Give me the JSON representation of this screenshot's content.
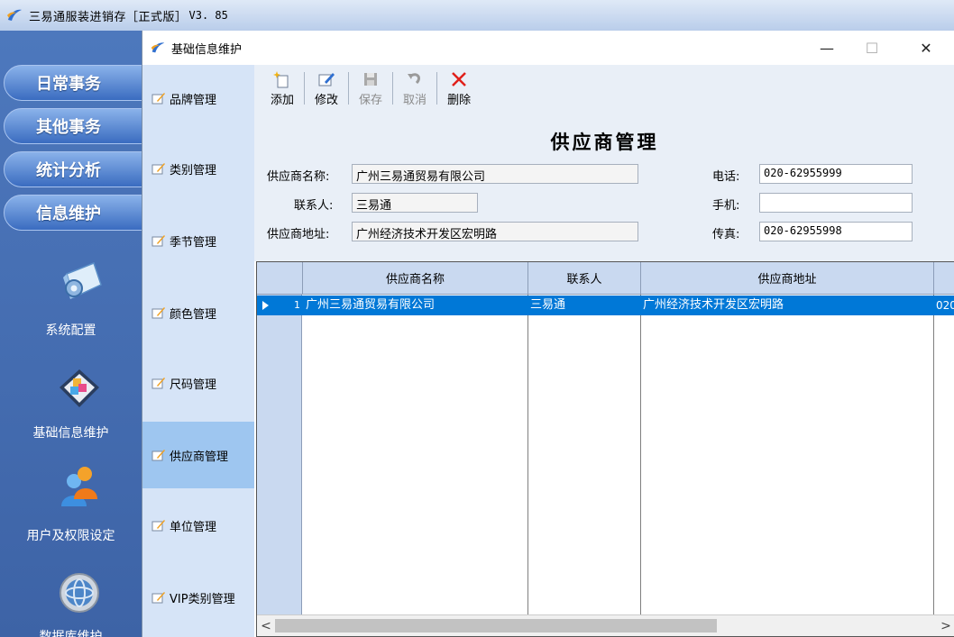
{
  "app": {
    "title": "三易通服装进销存［正式版］",
    "version": "V3. 85"
  },
  "outer_menu": {
    "buttons": [
      "日常事务",
      "其他事务",
      "统计分析",
      "信息维护"
    ],
    "tools": [
      {
        "label": "系统配置",
        "icon": "system-config-icon"
      },
      {
        "label": "基础信息维护",
        "icon": "basic-info-icon"
      },
      {
        "label": "用户及权限设定",
        "icon": "users-permission-icon"
      },
      {
        "label": "数据库维护",
        "icon": "database-icon"
      }
    ]
  },
  "dialog": {
    "title": "基础信息维护",
    "controls": {
      "minimize": "—",
      "maximize": "☐",
      "close": "✕"
    }
  },
  "nav": {
    "items": [
      "品牌管理",
      "类别管理",
      "季节管理",
      "颜色管理",
      "尺码管理",
      "供应商管理",
      "单位管理",
      "VIP类别管理"
    ],
    "active": "供应商管理"
  },
  "toolbar": {
    "add": "添加",
    "edit": "修改",
    "save": "保存",
    "cancel": "取消",
    "delete": "删除"
  },
  "form": {
    "title": "供应商管理",
    "name_label": "供应商名称:",
    "name_value": "广州三易通贸易有限公司",
    "contact_label": "联系人:",
    "contact_value": "三易通",
    "address_label": "供应商地址:",
    "address_value": "广州经济技术开发区宏明路",
    "phone_label": "电话:",
    "phone_value": "020-62955999",
    "mobile_label": "手机:",
    "mobile_value": "",
    "fax_label": "传真:",
    "fax_value": "020-62955998"
  },
  "grid": {
    "columns": [
      "供应商名称",
      "联系人",
      "供应商地址"
    ],
    "rows": [
      {
        "index": "1",
        "name": "广州三易通贸易有限公司",
        "contact": "三易通",
        "address": "广州经济技术开发区宏明路",
        "phone": "020"
      }
    ],
    "scroll_left": "<",
    "scroll_right": ">"
  },
  "colors": {
    "accent": "#0078d7",
    "nav_active": "#9ec6f0",
    "outer_bg": "#4a73b8"
  }
}
